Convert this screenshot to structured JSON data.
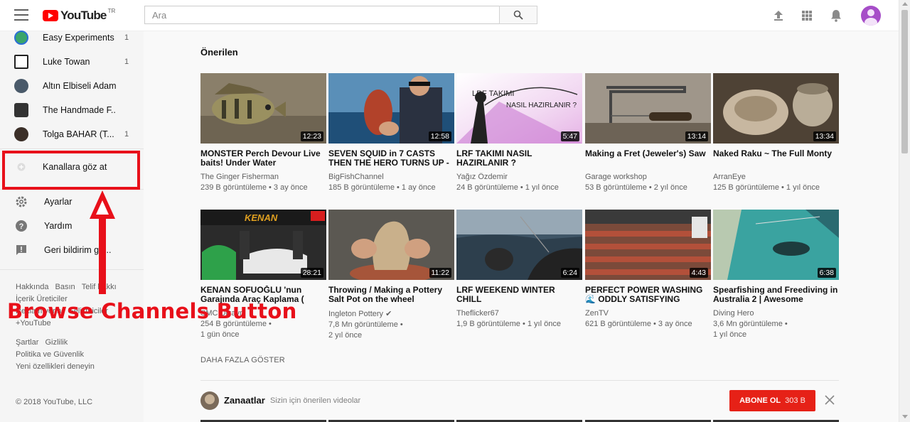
{
  "header": {
    "logo_text": "YouTube",
    "logo_country": "TR",
    "search_placeholder": "Ara",
    "icons": [
      "menu-icon",
      "search-icon",
      "upload-icon",
      "apps-icon",
      "notifications-icon",
      "account-avatar"
    ]
  },
  "sidebar": {
    "subscriptions": [
      {
        "name": "Easy Experiments",
        "count": "1",
        "avatar_color": "#3aa56b"
      },
      {
        "name": "Luke Towan",
        "count": "1",
        "avatar_color": "#222222"
      },
      {
        "name": "Altın Elbiseli Adam",
        "count": "",
        "avatar_color": "#4a5a6a"
      },
      {
        "name": "The Handmade F...",
        "count": "",
        "avatar_color": "#333333"
      },
      {
        "name": "Tolga BAHAR (T...",
        "count": "1",
        "avatar_color": "#3b2f28"
      }
    ],
    "browse_channels": "Kanallara göz at",
    "settings": "Ayarlar",
    "help": "Yardım",
    "feedback": "Geri bildirim gö...",
    "footer_links_1": [
      "Hakkında",
      "Basın",
      "Telif hakkı"
    ],
    "footer_links_2": [
      "İçerik Üreticiler"
    ],
    "footer_links_3": [
      "Reklam verin",
      "Geliştiriciler"
    ],
    "footer_links_4": [
      "+YouTube"
    ],
    "footer_links_5": [
      "Şartlar",
      "Gizlilik"
    ],
    "footer_links_6": [
      "Politika ve Güvenlik"
    ],
    "footer_links_7": [
      "Yeni özellikleri deneyin"
    ],
    "copyright": "© 2018 YouTube, LLC"
  },
  "annotation": {
    "label": "Browse Channels Button",
    "color": "#e8101a"
  },
  "main": {
    "section_title": "Önerilen",
    "videos_row1": [
      {
        "title": "MONSTER Perch Devour Live baits! Under Water",
        "channel": "The Ginger Fisherman",
        "meta": "239 B görüntüleme • 3 ay önce",
        "duration": "12:23"
      },
      {
        "title": "SEVEN SQUID in 7 CASTS THEN THE HERO TURNS UP -",
        "channel": "BigFishChannel",
        "meta": "185 B görüntüleme • 1 ay önce",
        "duration": "12:58"
      },
      {
        "title": "LRF TAKIMI NASIL HAZIRLANIR ?",
        "channel": "Yağız Özdemir",
        "meta": "24 B görüntüleme • 1 yıl önce",
        "duration": "5:47",
        "thumb_text_1": "LRF TAKIMI",
        "thumb_text_2": "NASIL HAZIRLANIR ?"
      },
      {
        "title": "Making a Fret (Jeweler's) Saw",
        "channel": "Garage workshop",
        "meta": "53 B görüntüleme • 2 yıl önce",
        "duration": "13:14"
      },
      {
        "title": "Naked Raku ~ The Full Monty",
        "channel": "ArranEye",
        "meta": "125 B görüntüleme • 1 yıl önce",
        "duration": "13:34"
      }
    ],
    "videos_row2": [
      {
        "title": "KENAN SOFUOĞLU 'nun Garajında Araç Kaplama (",
        "channel": "SMC Dizayn",
        "meta": "254 B görüntüleme •\n1 gün önce",
        "duration": "28:21",
        "thumb_text_1": "KENAN"
      },
      {
        "title": "Throwing / Making a Pottery Salt Pot on the wheel",
        "channel": "Ingleton Pottery ✔",
        "meta": "7,8 Mn görüntüleme •\n2 yıl önce",
        "duration": "11:22"
      },
      {
        "title": "LRF WEEKEND WINTER CHILL",
        "channel": "Theflicker67",
        "meta": "1,9 B görüntüleme • 1 yıl önce",
        "duration": "6:24"
      },
      {
        "title": "PERFECT POWER WASHING 🌊 ODDLY SATISFYING",
        "channel": "ZenTV",
        "meta": "621 B görüntüleme • 3 ay önce",
        "duration": "4:43"
      },
      {
        "title": "Spearfishing and Freediving in Australia 2 | Awesome",
        "channel": "Diving Hero",
        "meta": "3,6 Mn görüntüleme •\n1 yıl önce",
        "duration": "6:38"
      }
    ],
    "show_more": "DAHA FAZLA GÖSTER",
    "shelf": {
      "name": "Zanaatlar",
      "subtitle": "Sizin için önerilen videolar",
      "subscribe_label": "ABONE OL",
      "subscribe_count": "303 B"
    }
  }
}
